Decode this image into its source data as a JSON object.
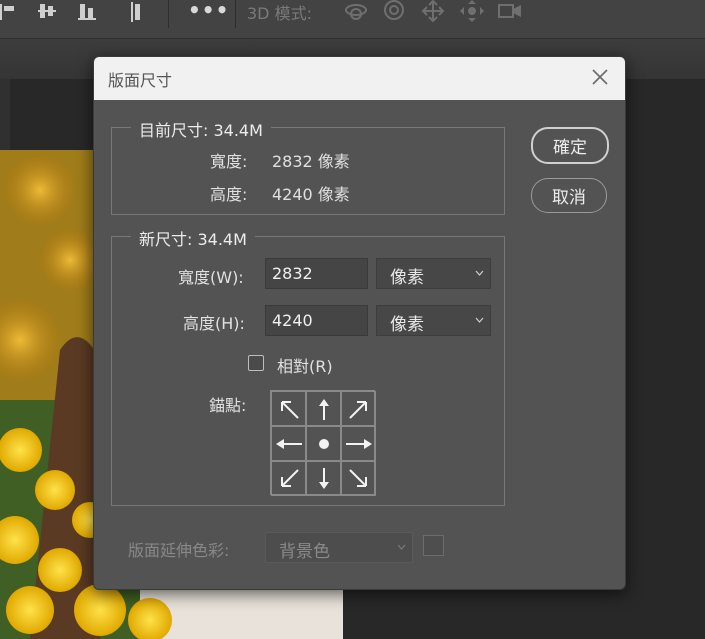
{
  "toolbar": {
    "more_label": "•••",
    "mode_3d_label": "3D 模式:"
  },
  "dialog": {
    "title": "版面尺寸",
    "current_size": {
      "legend": "目前尺寸: 34.4M",
      "width_label": "寬度:",
      "width_value": "2832 像素",
      "height_label": "高度:",
      "height_value": "4240 像素"
    },
    "new_size": {
      "legend": "新尺寸: 34.4M",
      "width_label": "寬度(W):",
      "width_value": "2832",
      "width_unit": "像素",
      "height_label": "高度(H):",
      "height_value": "4240",
      "height_unit": "像素",
      "relative_label": "相對(R)",
      "relative_checked": false,
      "anchor_label": "錨點:"
    },
    "extension_color_label": "版面延伸色彩:",
    "extension_color_value": "背景色",
    "ok_label": "確定",
    "cancel_label": "取消"
  }
}
